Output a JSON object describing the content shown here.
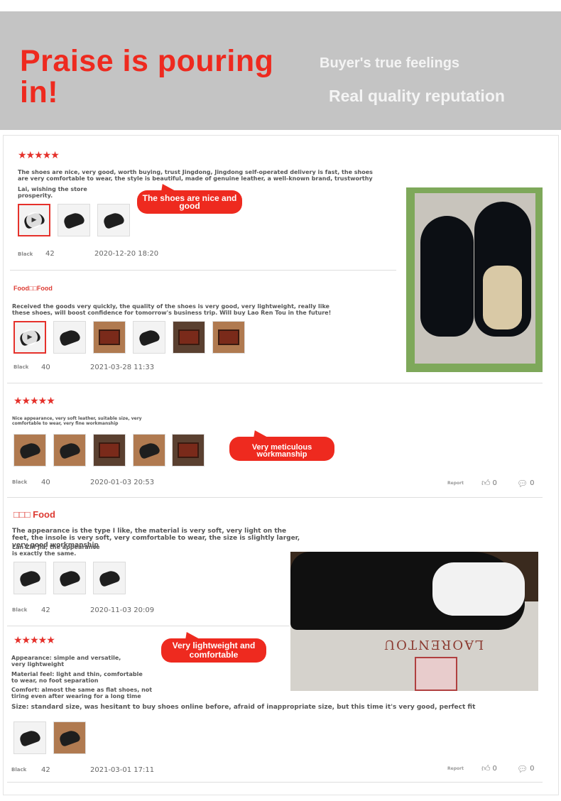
{
  "banner": {
    "title": "Praise is pouring in!",
    "subtitle1": "Buyer's true feelings",
    "subtitle2": "Real quality reputation"
  },
  "colors": {
    "accent": "#ee2a1f",
    "banner_bg": "#c4c4c4",
    "stars": "#e5312b"
  },
  "reviews": [
    {
      "stars": "★★★★★",
      "text": "The shoes are nice, very good, worth buying, trust Jingdong, Jingdong self-operated delivery is fast, the shoes are very comfortable to wear, the style is beautiful, made of genuine leather, a well-known brand, trustworthy",
      "text2": "Lai, wishing the store prosperity.",
      "color": "Black",
      "size": "42",
      "date": "2020-12-20 18:20",
      "bubble": "The shoes are nice and good"
    },
    {
      "user": "Food□□Food",
      "text": "Received the goods very quickly, the quality of the shoes is very good, very lightweight, really like these shoes, will boost confidence for tomorrow's business trip. Will buy Lao Ren Tou in the future!",
      "color": "Black",
      "size": "40",
      "date": "2021-03-28 11:33"
    },
    {
      "stars": "★★★★★",
      "text": "Nice appearance, very soft leather, suitable size, very comfortable to wear, very fine workmanship",
      "color": "Black",
      "size": "40",
      "date": "2020-01-03 20:53",
      "report": "Report",
      "likes": "0",
      "comments": "0",
      "bubble": "Very meticulous workmanship"
    },
    {
      "user": "□□□ Food",
      "text": "The appearance is the type I like, the material is very soft, very light on the feet, the insole is very soft, very comfortable to wear, the size is slightly larger, very good workmanship",
      "text2": "Lan Zhi Jia, the appearance is exactly the same.",
      "color": "Black",
      "size": "42",
      "date": "2020-11-03 20:09"
    },
    {
      "stars": "★★★★★",
      "line1": "Appearance: simple and versatile, very lightweight",
      "line2": "Material feel: light and thin, comfortable to wear, no foot separation",
      "line3": "Comfort: almost the same as flat shoes, not tiring even after wearing for a long time",
      "line4": "Size: standard size, was hesitant to buy shoes online before, afraid of inappropriate size, but this time it's very good, perfect fit",
      "color": "Black",
      "size": "42",
      "date": "2021-03-01 17:11",
      "report": "Report",
      "likes": "0",
      "comments": "0",
      "bubble": "Very lightweight and comfortable"
    }
  ],
  "photo_brand": "LAORENTOU"
}
